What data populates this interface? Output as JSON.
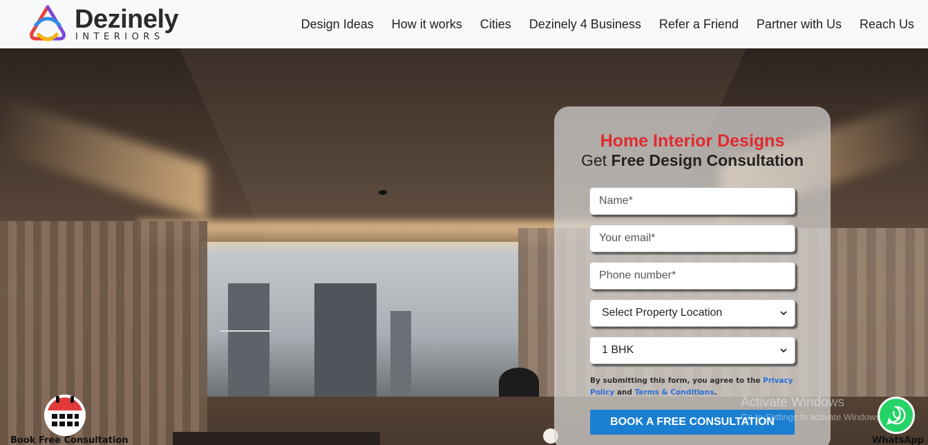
{
  "header": {
    "logo_name": "Dezinely",
    "logo_sub": "INTERIORS",
    "nav": [
      "Design Ideas",
      "How it works",
      "Cities",
      "Dezinely 4 Business",
      "Refer a Friend",
      "Partner with Us",
      "Reach Us"
    ]
  },
  "form": {
    "title": "Home Interior Designs",
    "subtitle_prefix": "Get ",
    "subtitle_bold": "Free Design Consultation",
    "name_placeholder": "Name*",
    "email_placeholder": "Your email*",
    "phone_placeholder": "Phone number*",
    "location_selected": "Select Property Location",
    "bhk_selected": "1 BHK",
    "consent_prefix": "By submitting this form, you agree to the ",
    "privacy_link": "Privacy Policy",
    "consent_and": " and ",
    "terms_link": "Terms & Conditions",
    "consent_end": ".",
    "cta": "BOOK A FREE CONSULTATION"
  },
  "floating": {
    "book_label": "Book Free Consultation",
    "whatsapp_label": "WhatsApp"
  },
  "watermark": {
    "line1": "Activate Windows",
    "line2": "Go to Settings to activate Windows."
  },
  "colors": {
    "title_red": "#e02a2f",
    "cta_blue": "#1a7fd1",
    "link_blue": "#2e6fd6",
    "whatsapp_green": "#25d366"
  }
}
